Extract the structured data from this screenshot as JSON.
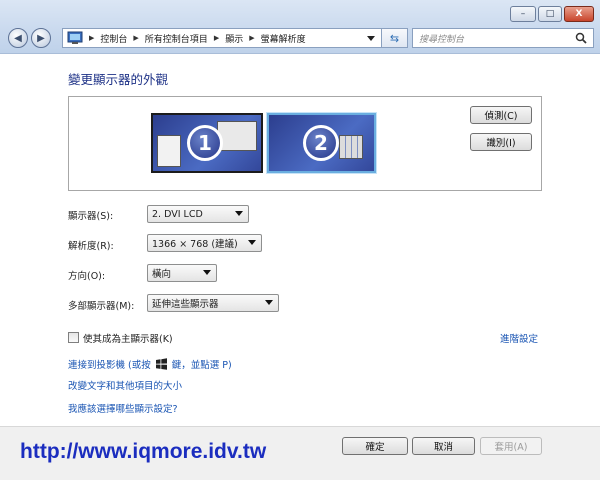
{
  "window": {
    "minimize_label": "–",
    "maximize_label": "□",
    "close_label": "X"
  },
  "address": {
    "crumbs": [
      "控制台",
      "所有控制台項目",
      "顯示",
      "螢幕解析度"
    ]
  },
  "search": {
    "placeholder": "搜尋控制台"
  },
  "page": {
    "title": "變更顯示器的外觀"
  },
  "monitors": [
    {
      "number": "1",
      "selected": false
    },
    {
      "number": "2",
      "selected": true
    }
  ],
  "buttons": {
    "detect": "偵測(C)",
    "identify": "識別(I)",
    "ok": "確定",
    "cancel": "取消",
    "apply": "套用(A)"
  },
  "fields": {
    "display": {
      "label": "顯示器(S):",
      "value": "2. DVI LCD"
    },
    "resolution": {
      "label": "解析度(R):",
      "value": "1366 × 768 (建議)"
    },
    "orientation": {
      "label": "方向(O):",
      "value": "橫向"
    },
    "multiple": {
      "label": "多部顯示器(M):",
      "value": "延伸這些顯示器"
    }
  },
  "main_display_checkbox": {
    "label": "使其成為主顯示器(K)",
    "checked": false
  },
  "links": {
    "advanced": "進階設定",
    "projector": "連接到投影機 (或按",
    "projector_suffix": "鍵，並點選 P)",
    "text_size": "改變文字和其他項目的大小",
    "which_settings": "我應該選擇哪些顯示設定?"
  },
  "watermark": "http://www.iqmore.idv.tw",
  "colors": {
    "title": "#1e3287",
    "link": "#1a55b3",
    "watermark": "#1b2dbf"
  }
}
